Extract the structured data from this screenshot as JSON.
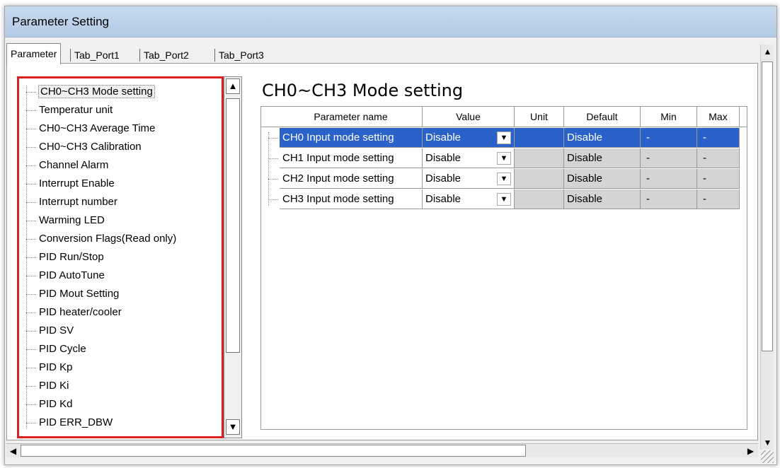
{
  "window": {
    "title": "Parameter Setting"
  },
  "tabs": [
    {
      "label": "Parameter",
      "active": true
    },
    {
      "label": "Tab_Port1",
      "active": false
    },
    {
      "label": "Tab_Port2",
      "active": false
    },
    {
      "label": "Tab_Port3",
      "active": false
    }
  ],
  "tree": {
    "selected_index": 0,
    "items": [
      "CH0~CH3 Mode setting",
      "Temperatur unit",
      "CH0~CH3 Average Time",
      "CH0~CH3 Calibration",
      "Channel Alarm",
      "Interrupt Enable",
      "Interrupt number",
      "Warming LED",
      "Conversion Flags(Read only)",
      "PID Run/Stop",
      "PID AutoTune",
      "PID Mout Setting",
      "PID heater/cooler",
      "PID SV",
      "PID Cycle",
      "PID Kp",
      "PID Ki",
      "PID Kd",
      "PID ERR_DBW"
    ]
  },
  "main": {
    "section_title": "CH0~CH3 Mode setting",
    "columns": [
      "Parameter name",
      "Value",
      "Unit",
      "Default",
      "Min",
      "Max"
    ],
    "rows": [
      {
        "name": "CH0 Input mode setting",
        "value": "Disable",
        "unit": "",
        "default": "Disable",
        "min": "-",
        "max": "-",
        "selected": true
      },
      {
        "name": "CH1 Input mode setting",
        "value": "Disable",
        "unit": "",
        "default": "Disable",
        "min": "-",
        "max": "-",
        "selected": false
      },
      {
        "name": "CH2 Input mode setting",
        "value": "Disable",
        "unit": "",
        "default": "Disable",
        "min": "-",
        "max": "-",
        "selected": false
      },
      {
        "name": "CH3 Input mode setting",
        "value": "Disable",
        "unit": "",
        "default": "Disable",
        "min": "-",
        "max": "-",
        "selected": false
      }
    ]
  },
  "icons": {
    "scroll_up": "triangle-up-icon",
    "scroll_down": "triangle-down-icon",
    "scroll_left": "triangle-left-icon",
    "scroll_right": "triangle-right-icon",
    "dropdown": "dropdown-arrow-icon",
    "resize": "resize-grip-icon"
  },
  "colors": {
    "highlight": "#2a62c9",
    "tree_border": "#e02020",
    "titlebar": "#c6d9ee"
  }
}
